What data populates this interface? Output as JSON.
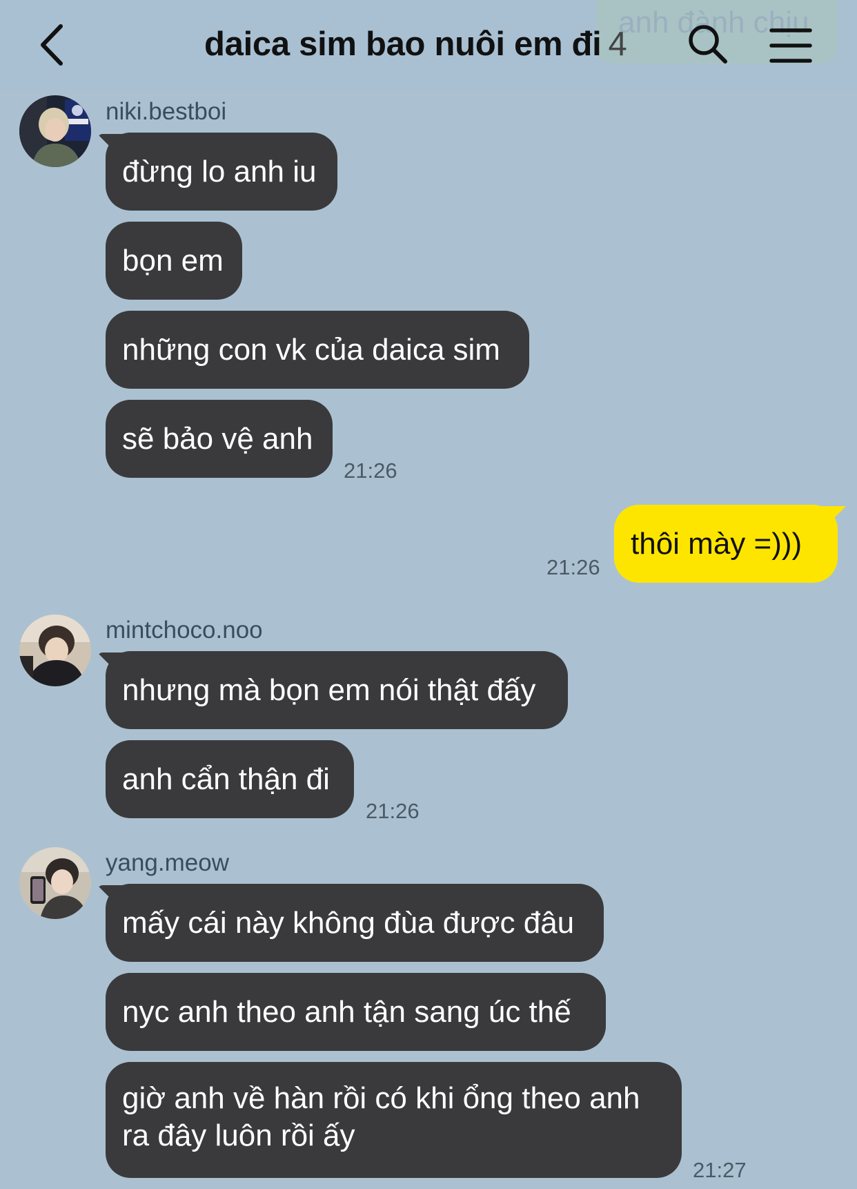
{
  "header": {
    "ghost_text": "anh đành chịu",
    "title": "daica sim bao nuôi em đi",
    "member_count": "4"
  },
  "groups": [
    {
      "sender": "niki.bestboi",
      "messages": [
        "đừng lo anh iu",
        "bọn em",
        "những con vk của daica sim",
        "sẽ bảo vệ anh"
      ],
      "time": "21:26"
    },
    {
      "mine": true,
      "messages": [
        "thôi mày =)))"
      ],
      "time": "21:26"
    },
    {
      "sender": "mintchoco.noo",
      "messages": [
        "nhưng mà bọn em nói thật đấy",
        "anh cẩn thận đi"
      ],
      "time": "21:26"
    },
    {
      "sender": "yang.meow",
      "messages": [
        "mấy cái này không đùa được đâu",
        "nyc anh theo anh tận sang úc thế",
        "giờ anh về hàn rồi có khi ổng theo anh ra đây luôn rồi ấy"
      ],
      "time": "21:27"
    }
  ],
  "colors": {
    "background": "#abc1d1",
    "bubble_other": "#3a3a3c",
    "bubble_mine": "#fee500"
  },
  "icons": [
    "back-chevron-icon",
    "search-icon",
    "menu-icon"
  ]
}
